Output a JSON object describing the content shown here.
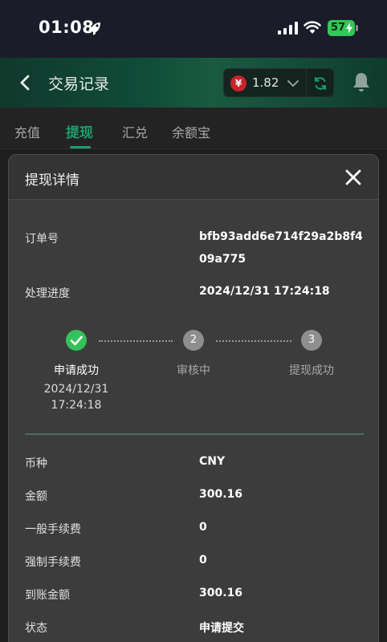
{
  "status_bar": {
    "time": "01:08",
    "battery": "57"
  },
  "header": {
    "title": "交易记录",
    "currency_symbol": "¥",
    "balance": "1.82"
  },
  "tabs": [
    {
      "label": "充值",
      "active": false
    },
    {
      "label": "提现",
      "active": true
    },
    {
      "label": "汇兑",
      "active": false
    },
    {
      "label": "余额宝",
      "active": false
    }
  ],
  "modal": {
    "title": "提现详情",
    "order": {
      "label": "订单号",
      "value": "bfb93add6e714f29a2b8f409a775"
    },
    "progress_row": {
      "label": "处理进度",
      "value": "2024/12/31 17:24:18"
    },
    "steps": [
      {
        "number": "",
        "label": "申请成功",
        "time": "2024/12/31\n17:24:18",
        "status": "done"
      },
      {
        "number": "2",
        "label": "审核中",
        "time": "",
        "status": "pending"
      },
      {
        "number": "3",
        "label": "提现成功",
        "time": "",
        "status": "pending"
      }
    ],
    "details": [
      {
        "label": "币种",
        "value": "CNY"
      },
      {
        "label": "金额",
        "value": "300.16"
      },
      {
        "label": "一般手续费",
        "value": "0"
      },
      {
        "label": "强制手续费",
        "value": "0"
      },
      {
        "label": "到账金额",
        "value": "300.16"
      },
      {
        "label": "状态",
        "value": "申请提交"
      }
    ]
  },
  "colors": {
    "accent": "#1f9e6b",
    "success": "#33c25b",
    "pending": "#8e8e8e"
  }
}
